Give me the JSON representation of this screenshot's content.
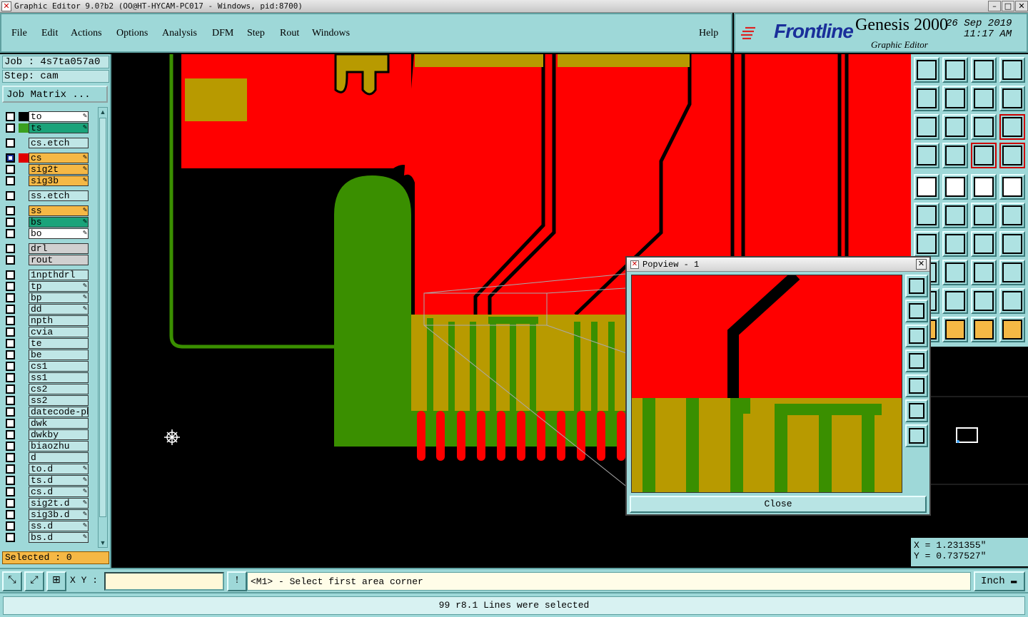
{
  "window": {
    "title": "Graphic Editor 9.0?b2 (OO@HT-HYCAM-PC017 - Windows, pid:8700)"
  },
  "menu": {
    "items": [
      "File",
      "Edit",
      "Actions",
      "Options",
      "Analysis",
      "DFM",
      "Step",
      "Rout",
      "Windows"
    ],
    "help": "Help"
  },
  "brand": {
    "logo": "Frontline",
    "product": "Genesis 2000",
    "subtitle": "Graphic Editor",
    "date": "26 Sep 2019",
    "time": "11:17 AM"
  },
  "job": {
    "job_label": "Job : 4s7ta057a0",
    "step_label": "Step: cam",
    "matrix_button": "Job Matrix ..."
  },
  "layers": [
    {
      "name": "to",
      "color": "#ffffff",
      "swatch": "#000000",
      "flag": "✎",
      "checked": false
    },
    {
      "name": "ts",
      "color": "#1aa37a",
      "swatch": "#3aa020",
      "flag": "✎",
      "checked": false
    },
    {
      "name": "cs.etch",
      "color": "#bfe6e6",
      "swatch": "",
      "flag": "",
      "checked": false,
      "gap": true
    },
    {
      "name": "cs",
      "color": "#f5b845",
      "swatch": "#e00000",
      "flag": "✎",
      "checked": true,
      "gap": true
    },
    {
      "name": "sig2t",
      "color": "#f5b845",
      "swatch": "",
      "flag": "✎",
      "checked": false
    },
    {
      "name": "sig3b",
      "color": "#f5b845",
      "swatch": "",
      "flag": "✎",
      "checked": false
    },
    {
      "name": "ss.etch",
      "color": "#bfe6e6",
      "swatch": "",
      "flag": "",
      "checked": false,
      "gap": true
    },
    {
      "name": "ss",
      "color": "#f5b845",
      "swatch": "",
      "flag": "✎",
      "checked": false,
      "gap": true
    },
    {
      "name": "bs",
      "color": "#1aa37a",
      "swatch": "",
      "flag": "✎",
      "checked": false
    },
    {
      "name": "bo",
      "color": "#ffffff",
      "swatch": "",
      "flag": "✎",
      "checked": false
    },
    {
      "name": "drl",
      "color": "#d0d0d0",
      "swatch": "",
      "flag": "",
      "checked": false,
      "gap": true
    },
    {
      "name": "rout",
      "color": "#d0d0d0",
      "swatch": "",
      "flag": "",
      "checked": false
    },
    {
      "name": "1npthdrl",
      "color": "#bfe6e6",
      "swatch": "",
      "flag": "",
      "checked": false,
      "gap": true
    },
    {
      "name": "tp",
      "color": "#bfe6e6",
      "swatch": "",
      "flag": "✎",
      "checked": false
    },
    {
      "name": "bp",
      "color": "#bfe6e6",
      "swatch": "",
      "flag": "✎",
      "checked": false
    },
    {
      "name": "dd",
      "color": "#bfe6e6",
      "swatch": "",
      "flag": "✎",
      "checked": false
    },
    {
      "name": "npth",
      "color": "#bfe6e6",
      "swatch": "",
      "flag": "",
      "checked": false
    },
    {
      "name": "cvia",
      "color": "#bfe6e6",
      "swatch": "",
      "flag": "",
      "checked": false
    },
    {
      "name": "te",
      "color": "#bfe6e6",
      "swatch": "",
      "flag": "",
      "checked": false
    },
    {
      "name": "be",
      "color": "#bfe6e6",
      "swatch": "",
      "flag": "",
      "checked": false
    },
    {
      "name": "cs1",
      "color": "#bfe6e6",
      "swatch": "",
      "flag": "",
      "checked": false
    },
    {
      "name": "ss1",
      "color": "#bfe6e6",
      "swatch": "",
      "flag": "",
      "checked": false
    },
    {
      "name": "cs2",
      "color": "#bfe6e6",
      "swatch": "",
      "flag": "",
      "checked": false
    },
    {
      "name": "ss2",
      "color": "#bfe6e6",
      "swatch": "",
      "flag": "",
      "checked": false
    },
    {
      "name": "datecode-pbe",
      "color": "#bfe6e6",
      "swatch": "",
      "flag": "",
      "checked": false
    },
    {
      "name": "dwk",
      "color": "#bfe6e6",
      "swatch": "",
      "flag": "",
      "checked": false
    },
    {
      "name": "dwkby",
      "color": "#bfe6e6",
      "swatch": "",
      "flag": "",
      "checked": false
    },
    {
      "name": "biaozhu",
      "color": "#bfe6e6",
      "swatch": "",
      "flag": "",
      "checked": false
    },
    {
      "name": "d",
      "color": "#bfe6e6",
      "swatch": "",
      "flag": "",
      "checked": false
    },
    {
      "name": "to.d",
      "color": "#bfe6e6",
      "swatch": "",
      "flag": "✎",
      "checked": false
    },
    {
      "name": "ts.d",
      "color": "#bfe6e6",
      "swatch": "",
      "flag": "✎",
      "checked": false
    },
    {
      "name": "cs.d",
      "color": "#bfe6e6",
      "swatch": "",
      "flag": "✎",
      "checked": false
    },
    {
      "name": "sig2t.d",
      "color": "#bfe6e6",
      "swatch": "",
      "flag": "✎",
      "checked": false
    },
    {
      "name": "sig3b.d",
      "color": "#bfe6e6",
      "swatch": "",
      "flag": "✎",
      "checked": false
    },
    {
      "name": "ss.d",
      "color": "#bfe6e6",
      "swatch": "",
      "flag": "✎",
      "checked": false
    },
    {
      "name": "bs.d",
      "color": "#bfe6e6",
      "swatch": "",
      "flag": "✎",
      "checked": false
    }
  ],
  "selected": "Selected : 0",
  "coords": {
    "x": "X = 1.231355\"",
    "y": "Y = 0.737527\""
  },
  "bottom": {
    "xy_label": "X Y :",
    "xy_value": "",
    "prompt": "<M1> - Select first area corner",
    "unit": "Inch"
  },
  "status": "99 r8.1 Lines were selected",
  "popview": {
    "title": "Popview - 1",
    "close": "Close"
  },
  "colors": {
    "panel": "#9ed8d8",
    "copper": "#ff0000",
    "mask": "#3a8f00",
    "pad": "#b89a00"
  }
}
